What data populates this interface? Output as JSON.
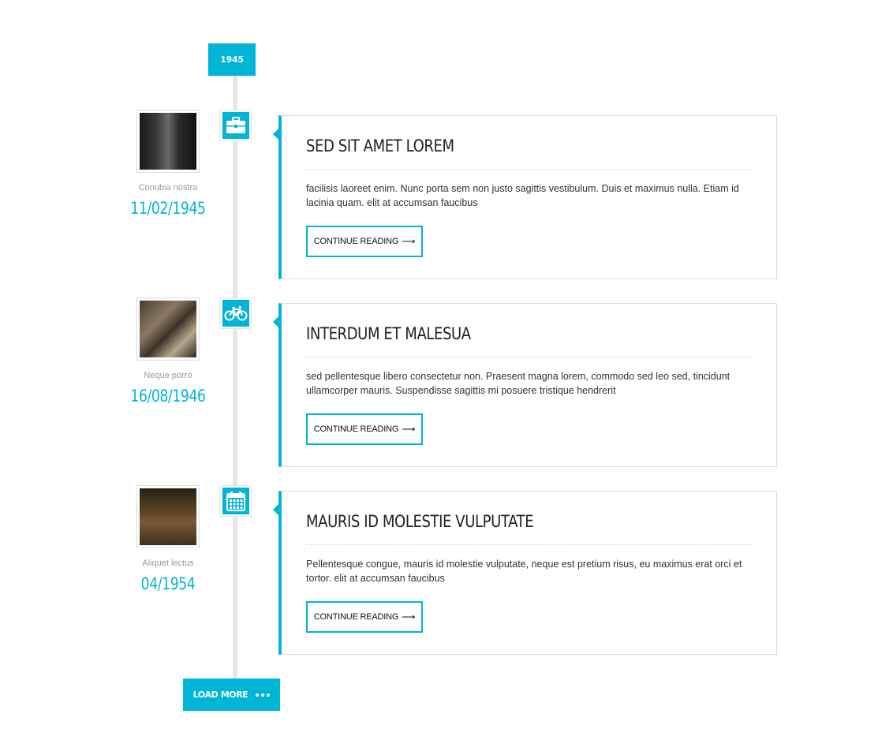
{
  "timeline": {
    "year": "1945",
    "entries": [
      {
        "label": "Conubia nostra",
        "date": "11/02/1945",
        "icon": "briefcase-icon",
        "title": "SED SIT AMET LOREM",
        "excerpt": "facilisis laoreet enim. Nunc porta sem non justo sagittis vestibulum. Duis et maximus nulla. Etiam id lacinia quam. elit at accumsan faucibus",
        "button": "CONTINUE READING"
      },
      {
        "label": "Neque porro",
        "date": "16/08/1946",
        "icon": "bicycle-icon",
        "title": "INTERDUM ET MALESUA",
        "excerpt": "sed pellentesque libero consectetur non. Praesent magna lorem, commodo sed leo sed, tincidunt ullamcorper mauris. Suspendisse sagittis mi posuere tristique hendrerit",
        "button": "CONTINUE READING"
      },
      {
        "label": "Aliquet lectus",
        "date": "04/1954",
        "icon": "calendar-icon",
        "title": "MAURIS ID MOLESTIE VULPUTATE",
        "excerpt": "Pellentesque congue, mauris id molestie vulputate, neque est pretium risus, eu maximus erat orci et tortor. elit at accumsan faucibus",
        "button": "CONTINUE READING"
      }
    ],
    "load_more": "LOAD MORE"
  },
  "colors": {
    "accent": "#00b5d5",
    "line": "#e6e6e6",
    "border": "#dcdcdc"
  }
}
